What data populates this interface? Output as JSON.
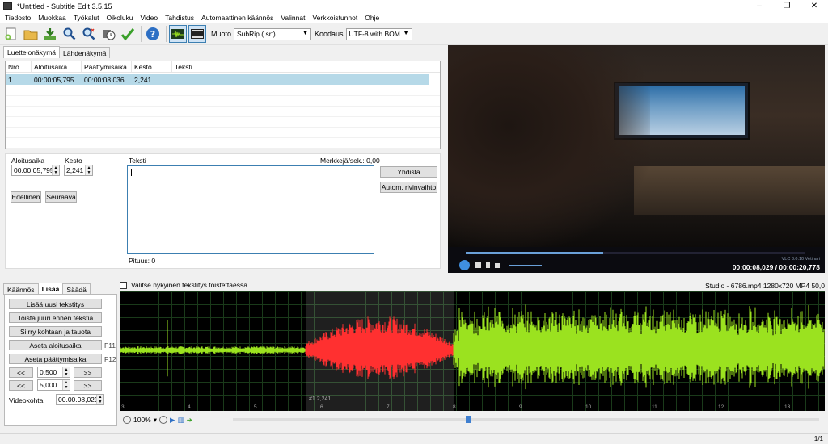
{
  "window": {
    "title": "*Untitled - Subtitle Edit 3.5.15",
    "minimize": "–",
    "maximize": "❐",
    "close": "✕"
  },
  "menu": [
    "Tiedosto",
    "Muokkaa",
    "Työkalut",
    "Oikoluku",
    "Video",
    "Tahdistus",
    "Automaattinen käännös",
    "Valinnat",
    "Verkkoistunnot",
    "Ohje"
  ],
  "toolbar": {
    "icons": [
      "new-file-icon",
      "open-folder-icon",
      "download-icon",
      "find-icon",
      "replace-icon",
      "sync-icon",
      "check-icon",
      "help-icon",
      "waveform-icon",
      "video-icon"
    ],
    "format_label": "Muoto",
    "format_value": "SubRip (.srt)",
    "encoding_label": "Koodaus",
    "encoding_value": "UTF-8 with BOM"
  },
  "tabs_top": [
    "Luettelonäkymä",
    "Lähdenäkymä"
  ],
  "list": {
    "headers": [
      "Nro.",
      "Aloitusaika",
      "Päättymisaika",
      "Kesto",
      "Teksti"
    ],
    "rows": [
      {
        "nro": "1",
        "start": "00:00:05,795",
        "end": "00:00:08,036",
        "duration": "2,241",
        "text": ""
      }
    ]
  },
  "edit": {
    "start_label": "Aloitusaika",
    "start_value": "00.00.05,795",
    "duration_label": "Kesto",
    "duration_value": "2,241",
    "text_label": "Teksti",
    "chars_label": "Merkkejä/sek.: 0,00",
    "prev_button": "Edellinen",
    "next_button": "Seuraava",
    "merge_button": "Yhdistä",
    "autobreak_button": "Autom. rivinvaihto",
    "length_label": "Pituus: 0"
  },
  "video": {
    "time": "00:00:08,029 / 00:00:20,778",
    "vlc_label": "VLC 3.0.10 Vetinari"
  },
  "tabs_bottom": [
    "Käännös",
    "Lisää",
    "Säädä"
  ],
  "create": {
    "add_button": "Lisää uusi tekstitys",
    "play_before_button": "Toista juuri ennen tekstiä",
    "goto_pause_button": "Siirry kohtaan ja tauota",
    "set_start_button": "Aseta aloitusaika",
    "set_start_key": "F11",
    "set_end_button": "Aseta päättymisaika",
    "set_end_key": "F12",
    "back_label": "<<",
    "forward_label": ">>",
    "step1_value": "0,500",
    "step2_value": "5,000",
    "video_pos_label": "Videokohta:",
    "video_pos_value": "00.00.08,029"
  },
  "waveform": {
    "checkbox_label": "Valitse nykyinen tekstitys toistettaessa",
    "info": "Studio - 6786.mp4 1280x720 MP4 50,0",
    "selection_label": "#1  2,241",
    "ticks": [
      "3",
      "4",
      "5",
      "6",
      "7",
      "8",
      "9",
      "10",
      "11",
      "12",
      "13"
    ],
    "zoom": "100%",
    "colors": {
      "wave": "#9be21f",
      "selected": "#ff3030",
      "background": "#000000"
    }
  },
  "status": {
    "page": "1/1"
  }
}
